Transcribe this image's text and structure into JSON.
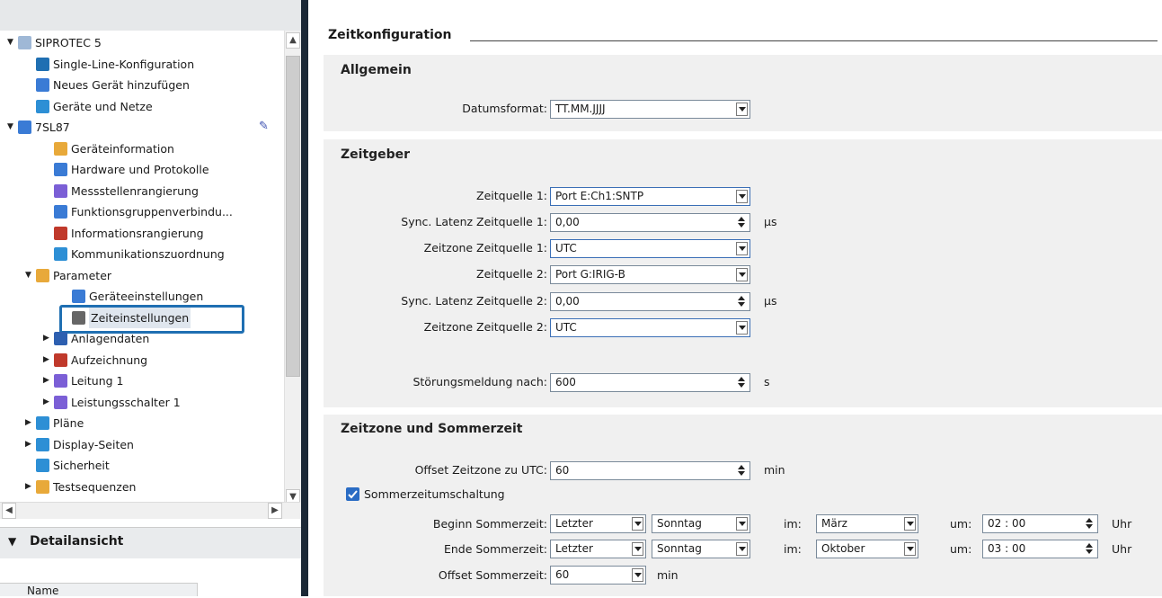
{
  "tree": {
    "items": [
      {
        "label": "SIPROTEC 5",
        "level": 0,
        "expanded": "open"
      },
      {
        "label": "Single-Line-Konfiguration",
        "level": 1,
        "expanded": ""
      },
      {
        "label": "Neues Gerät hinzufügen",
        "level": 1,
        "expanded": ""
      },
      {
        "label": "Geräte und Netze",
        "level": 1,
        "expanded": ""
      },
      {
        "label": "7SL87",
        "level": 0,
        "expanded": "open"
      },
      {
        "label": "Geräteinformation",
        "level": 2,
        "expanded": ""
      },
      {
        "label": "Hardware und Protokolle",
        "level": 2,
        "expanded": ""
      },
      {
        "label": "Messstellenrangierung",
        "level": 2,
        "expanded": ""
      },
      {
        "label": "Funktionsgruppenverbindu...",
        "level": 2,
        "expanded": ""
      },
      {
        "label": "Informationsrangierung",
        "level": 2,
        "expanded": ""
      },
      {
        "label": "Kommunikationszuordnung",
        "level": 2,
        "expanded": ""
      },
      {
        "label": "Parameter",
        "level": 1,
        "expanded": "open"
      },
      {
        "label": "Geräteeinstellungen",
        "level": 3,
        "expanded": ""
      },
      {
        "label": "Zeiteinstellungen",
        "level": 3,
        "expanded": "",
        "selected": true
      },
      {
        "label": "Anlagendaten",
        "level": 2,
        "expanded": "closed"
      },
      {
        "label": "Aufzeichnung",
        "level": 2,
        "expanded": "closed"
      },
      {
        "label": "Leitung 1",
        "level": 2,
        "expanded": "closed"
      },
      {
        "label": "Leistungsschalter 1",
        "level": 2,
        "expanded": "closed"
      },
      {
        "label": "Pläne",
        "level": 1,
        "expanded": "closed"
      },
      {
        "label": "Display-Seiten",
        "level": 1,
        "expanded": "closed"
      },
      {
        "label": "Sicherheit",
        "level": 1,
        "expanded": ""
      },
      {
        "label": "Testsequenzen",
        "level": 1,
        "expanded": "closed"
      }
    ],
    "highlight_color": "#1f6fb2"
  },
  "detail": {
    "title": "Detailansicht",
    "name_column": "Name"
  },
  "content": {
    "title": "Zeitkonfiguration",
    "sections": {
      "allgemein": {
        "title": "Allgemein",
        "datumsformat_label": "Datumsformat:",
        "datumsformat_value": "TT.MM.JJJJ"
      },
      "zeitgeber": {
        "title": "Zeitgeber",
        "zq1_label": "Zeitquelle 1:",
        "zq1_value": "Port E:Ch1:SNTP",
        "lat1_label": "Sync. Latenz Zeitquelle 1:",
        "lat1_value": "0,00",
        "lat1_unit": "µs",
        "tz1_label": "Zeitzone Zeitquelle 1:",
        "tz1_value": "UTC",
        "zq2_label": "Zeitquelle 2:",
        "zq2_value": "Port G:IRIG-B",
        "lat2_label": "Sync. Latenz Zeitquelle 2:",
        "lat2_value": "0,00",
        "lat2_unit": "µs",
        "tz2_label": "Zeitzone Zeitquelle 2:",
        "tz2_value": "UTC",
        "stoer_label": "Störungsmeldung nach:",
        "stoer_value": "600",
        "stoer_unit": "s"
      },
      "zeitzone": {
        "title": "Zeitzone und Sommerzeit",
        "offset_label": "Offset Zeitzone zu UTC:",
        "offset_value": "60",
        "offset_unit": "min",
        "dst_checkbox_label": "Sommerzeitumschaltung",
        "dst_checked": true,
        "begin_label": "Beginn Sommerzeit:",
        "begin_week": "Letzter",
        "begin_day": "Sonntag",
        "begin_im": "im:",
        "begin_month": "März",
        "begin_um": "um:",
        "begin_time": "02 : 00",
        "begin_unit": "Uhr",
        "end_label": "Ende Sommerzeit:",
        "end_week": "Letzter",
        "end_day": "Sonntag",
        "end_im": "im:",
        "end_month": "Oktober",
        "end_um": "um:",
        "end_time": "03 : 00",
        "end_unit": "Uhr",
        "offset_dst_label": "Offset Sommerzeit:",
        "offset_dst_value": "60",
        "offset_dst_unit": "min"
      }
    }
  }
}
